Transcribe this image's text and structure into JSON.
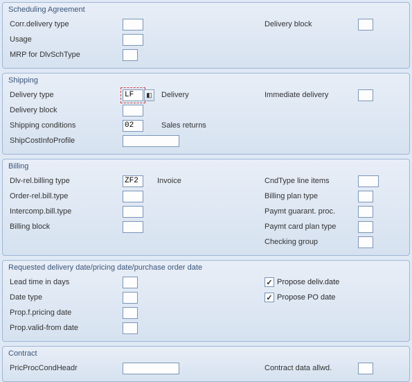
{
  "sched": {
    "title": "Scheduling Agreement",
    "corr_delivery_type": {
      "label": "Corr.delivery type",
      "value": ""
    },
    "usage": {
      "label": "Usage",
      "value": ""
    },
    "mrp_dlvschtype": {
      "label": "MRP for DlvSchType",
      "value": ""
    },
    "delivery_block": {
      "label": "Delivery block",
      "value": ""
    }
  },
  "shipping": {
    "title": "Shipping",
    "delivery_type": {
      "label": "Delivery type",
      "value": "LF",
      "desc": "Delivery"
    },
    "delivery_block": {
      "label": "Delivery block",
      "value": ""
    },
    "shipping_conditions": {
      "label": "Shipping conditions",
      "value": "02",
      "desc": "Sales returns"
    },
    "shipcost": {
      "label": "ShipCostInfoProfile",
      "value": ""
    },
    "immediate_delivery": {
      "label": "Immediate delivery",
      "value": ""
    }
  },
  "billing": {
    "title": "Billing",
    "dlv_rel": {
      "label": "Dlv-rel.billing type",
      "value": "ZF2",
      "desc": "Invoice"
    },
    "order_rel": {
      "label": "Order-rel.bill.type",
      "value": ""
    },
    "intercomp": {
      "label": "Intercomp.bill.type",
      "value": ""
    },
    "billing_block": {
      "label": "Billing block",
      "value": ""
    },
    "cndtype": {
      "label": "CndType line items",
      "value": ""
    },
    "plan_type": {
      "label": "Billing plan type",
      "value": ""
    },
    "paymt_guarant": {
      "label": "Paymt guarant. proc.",
      "value": ""
    },
    "paymt_card": {
      "label": "Paymt card plan type",
      "value": ""
    },
    "checking_group": {
      "label": "Checking group",
      "value": ""
    }
  },
  "reqdate": {
    "title": "Requested delivery date/pricing date/purchase order date",
    "lead_time": {
      "label": "Lead time in days",
      "value": ""
    },
    "date_type": {
      "label": "Date type",
      "value": ""
    },
    "prop_pricing": {
      "label": "Prop.f.pricing date",
      "value": ""
    },
    "prop_valid": {
      "label": "Prop.valid-from date",
      "value": ""
    },
    "propose_deliv": {
      "label": "Propose deliv.date",
      "checked": true
    },
    "propose_po": {
      "label": "Propose PO date",
      "checked": true
    }
  },
  "contract": {
    "title": "Contract",
    "pricproc": {
      "label": "PricProcCondHeadr",
      "value": ""
    },
    "data_allwd": {
      "label": "Contract data allwd.",
      "value": ""
    }
  }
}
